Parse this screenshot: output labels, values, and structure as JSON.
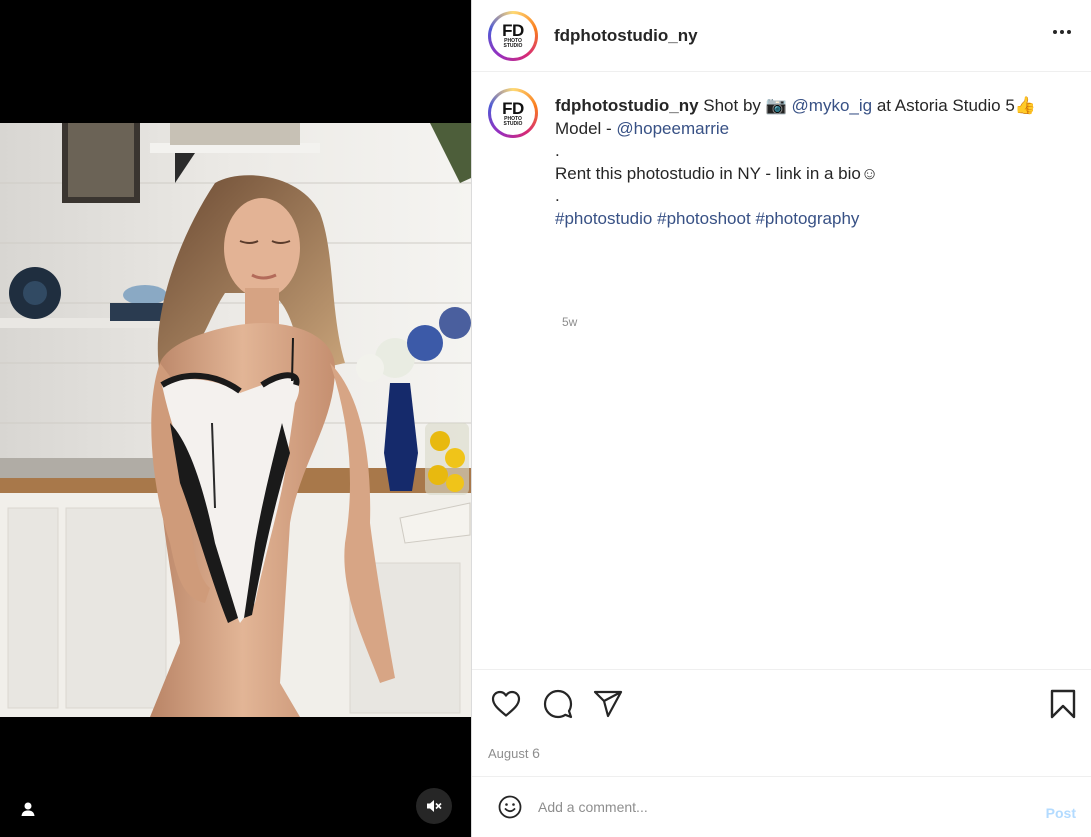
{
  "header": {
    "username": "fdphotostudio_ny",
    "logo_fd": "FD",
    "logo_sub1": "PHOTO",
    "logo_sub2": "STUDIO"
  },
  "caption": {
    "username": "fdphotostudio_ny",
    "line1_pre": " Shot by 📷 ",
    "mention_photographer": "@myko_ig",
    "line1_post": " at Astoria Studio 5👍",
    "line2_pre": "Model - ",
    "mention_model": "@hopeemarrie",
    "dot1": ".",
    "line3": "Rent this photostudio in NY - link in a bio☺",
    "dot2": ".",
    "hashtags": [
      "#photostudio",
      "#photoshoot",
      "#photography"
    ],
    "time_ago": "5w"
  },
  "post": {
    "date_month": "August",
    "date_day": "6"
  },
  "comment": {
    "placeholder": "Add a comment...",
    "post_label": "Post"
  },
  "icons": {
    "more": "more-options-icon",
    "like": "heart-icon",
    "comment": "comment-icon",
    "share": "share-icon",
    "save": "bookmark-icon",
    "emoji": "emoji-icon",
    "user_tag": "user-icon",
    "mute": "volume-muted-icon"
  },
  "colors": {
    "link": "#385185",
    "post_disabled": "#b3dbff",
    "secondary_text": "#8e8e8e"
  }
}
